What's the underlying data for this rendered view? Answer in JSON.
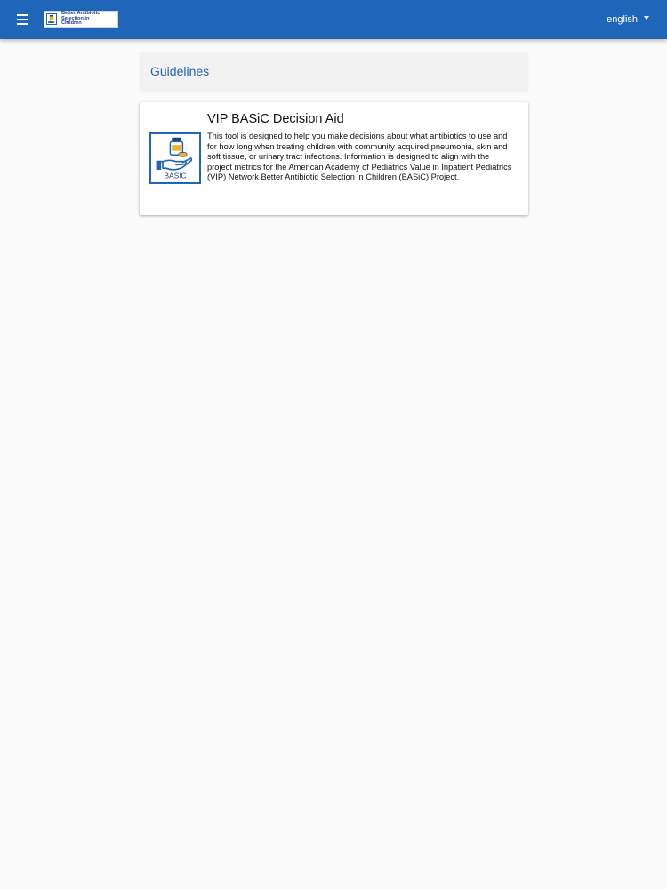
{
  "header": {
    "menu_icon": "hamburger-menu-icon",
    "logo_text": "Better Antibiotic\nSelection in\nChildren",
    "language_label": "english",
    "language_icon": "caret-down-icon",
    "colors": {
      "bar": "#1f65b8",
      "text": "#ffffff"
    }
  },
  "main": {
    "section_title": "Guidelines",
    "cards": [
      {
        "title": "VIP BASiC Decision Aid",
        "icon_label": "BASIC",
        "description": "This tool is designed to help you make decisions about what antibiotics to use and for how long when treating children with community acquired pneumonia, skin and soft tissue, or urinary tract infections. Information is designed to align with the project metrics for the American Academy of Pediatrics Value in Inpatient Pediatrics (VIP) Network Better Antibiotic Selection in Children (BASiC) Project."
      }
    ]
  }
}
